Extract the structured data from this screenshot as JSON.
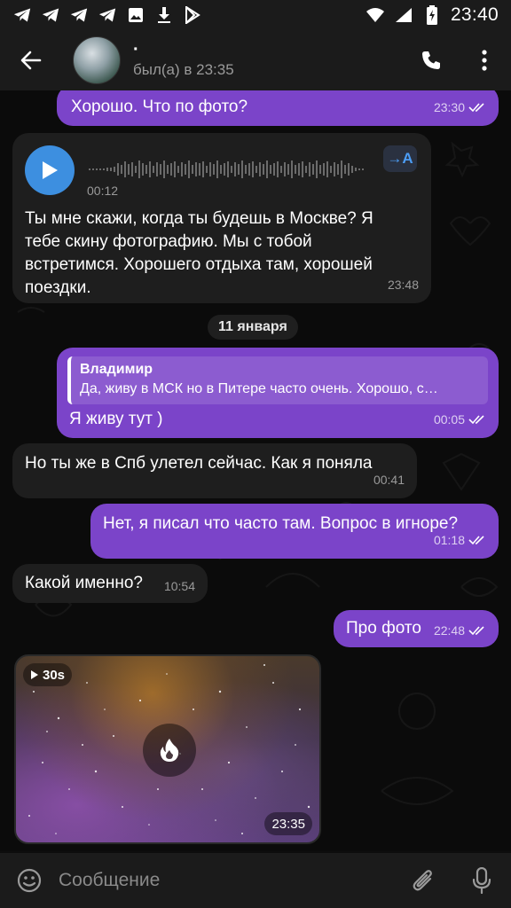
{
  "status_bar": {
    "time": "23:40",
    "left_icons": [
      "telegram-icon",
      "telegram-icon",
      "telegram-icon",
      "telegram-icon",
      "gallery-icon",
      "download-icon",
      "play-store-icon"
    ],
    "right_icons": [
      "wifi-icon",
      "signal-icon",
      "battery-charging-icon"
    ]
  },
  "header": {
    "name": "·",
    "status": "был(а) в 23:35"
  },
  "messages": {
    "m1": {
      "text": "Хорошо. Что по фото?",
      "time": "23:30"
    },
    "voice": {
      "duration": "00:12",
      "transcribe_label": "→A",
      "text": "Ты мне скажи, когда ты будешь в Москве? Я тебе скину фотографию. Мы с тобой встретимся. Хорошего отдыха там, хорошей поездки.",
      "time": "23:48"
    },
    "date_separator": "11 января",
    "reply": {
      "quote_author": "Владимир",
      "quote_text": "Да, живу в МСК но в Питере часто очень. Хорошо, с…",
      "text": "Я живу тут )",
      "time": "00:05"
    },
    "m4": {
      "text": "Но ты же в Спб улетел сейчас.  Как я поняла",
      "time": "00:41"
    },
    "m5": {
      "text": "Нет, я писал что часто там. Вопрос в игноре?",
      "time": "01:18"
    },
    "m6": {
      "text": "Какой именно?",
      "time": "10:54"
    },
    "m7": {
      "text": "Про фото",
      "time": "22:48"
    },
    "video": {
      "duration": "30s",
      "time": "23:35"
    }
  },
  "input": {
    "placeholder": "Сообщение"
  },
  "colors": {
    "outgoing_bubble": "#7b44c9",
    "incoming_bubble": "#1e1e1e",
    "accent": "#3d8fe0",
    "background": "#0b0b0b"
  }
}
